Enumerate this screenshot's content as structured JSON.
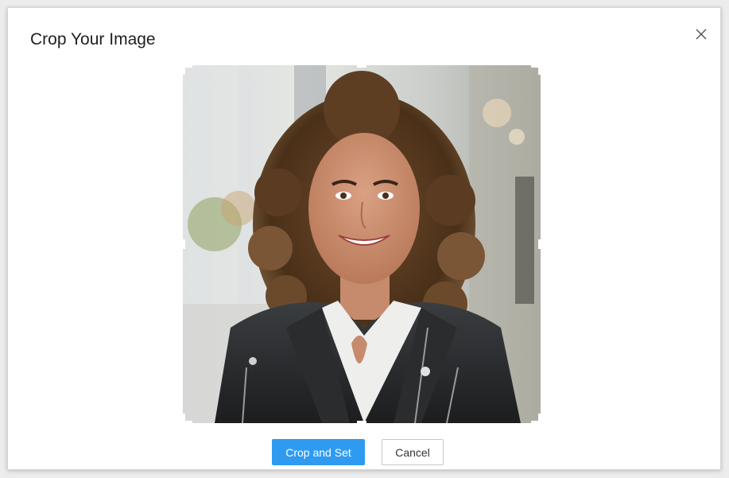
{
  "dialog": {
    "title": "Crop Your Image",
    "close_icon": "close-icon"
  },
  "cropper": {
    "image_alt": "Portrait photo being cropped",
    "handle_color": "#ffffff"
  },
  "actions": {
    "crop_label": "Crop and Set",
    "cancel_label": "Cancel"
  },
  "colors": {
    "primary": "#2e9bf0",
    "title_text": "#1f1f1f"
  }
}
